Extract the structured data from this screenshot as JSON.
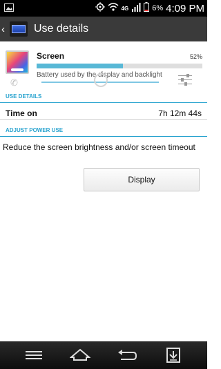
{
  "status_bar": {
    "network": "4G",
    "battery_percent": "6%",
    "time": "4:09 PM"
  },
  "action_bar": {
    "title": "Use details"
  },
  "item": {
    "name": "Screen",
    "percent": "52%",
    "usage_fraction": 0.52,
    "description": "Battery used by the display and backlight"
  },
  "sections": {
    "use_details": "USE DETAILS",
    "adjust_power_use": "ADJUST POWER USE"
  },
  "time_on": {
    "label": "Time on",
    "value": "7h 12m 44s"
  },
  "advice": {
    "text": "Reduce the screen brightness and/or screen timeout",
    "button_label": "Display"
  },
  "icons": {
    "status_left": "image-icon",
    "location": "gps-icon",
    "wifi": "wifi-icon",
    "signal": "signal-icon",
    "battery": "battery-icon",
    "back": "back-chevron-icon",
    "app": "battery-app-icon",
    "screen": "screen-thumb-icon",
    "phone": "phone-icon",
    "settings": "sliders-icon",
    "nav": [
      "menu-icon",
      "home-icon",
      "back-icon",
      "notification-icon"
    ]
  },
  "colors": {
    "accent": "#28a3cf",
    "bar_fill": "#58b8d6",
    "action_bar": "#3a3a3a"
  }
}
